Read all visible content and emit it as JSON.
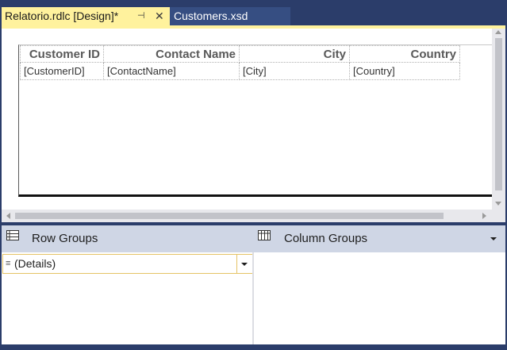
{
  "tabs": [
    {
      "label": "Relatorio.rdlc [Design]*",
      "active": true,
      "pin_icon": "pin-icon",
      "close_icon": "close-icon"
    },
    {
      "label": "Customers.xsd",
      "active": false
    }
  ],
  "tabs_glyphs": {
    "pin": "⊣",
    "close": "✕"
  },
  "tablix": {
    "headers": [
      "Customer ID",
      "Contact Name",
      "City",
      "Country"
    ],
    "fields": [
      "[CustomerID]",
      "[ContactName]",
      "[City]",
      "[Country]"
    ]
  },
  "grouping": {
    "row_groups_label": "Row Groups",
    "column_groups_label": "Column Groups",
    "row_groups": [
      {
        "label": "(Details)",
        "icon": "details-lines-icon",
        "glyph": "≡"
      }
    ]
  },
  "colors": {
    "frame": "#2b3d6a",
    "active_tab": "#fff29d",
    "inactive_tab": "#364e82",
    "grouping_header": "#cfd6e5",
    "group_item_border": "#e5c365"
  }
}
